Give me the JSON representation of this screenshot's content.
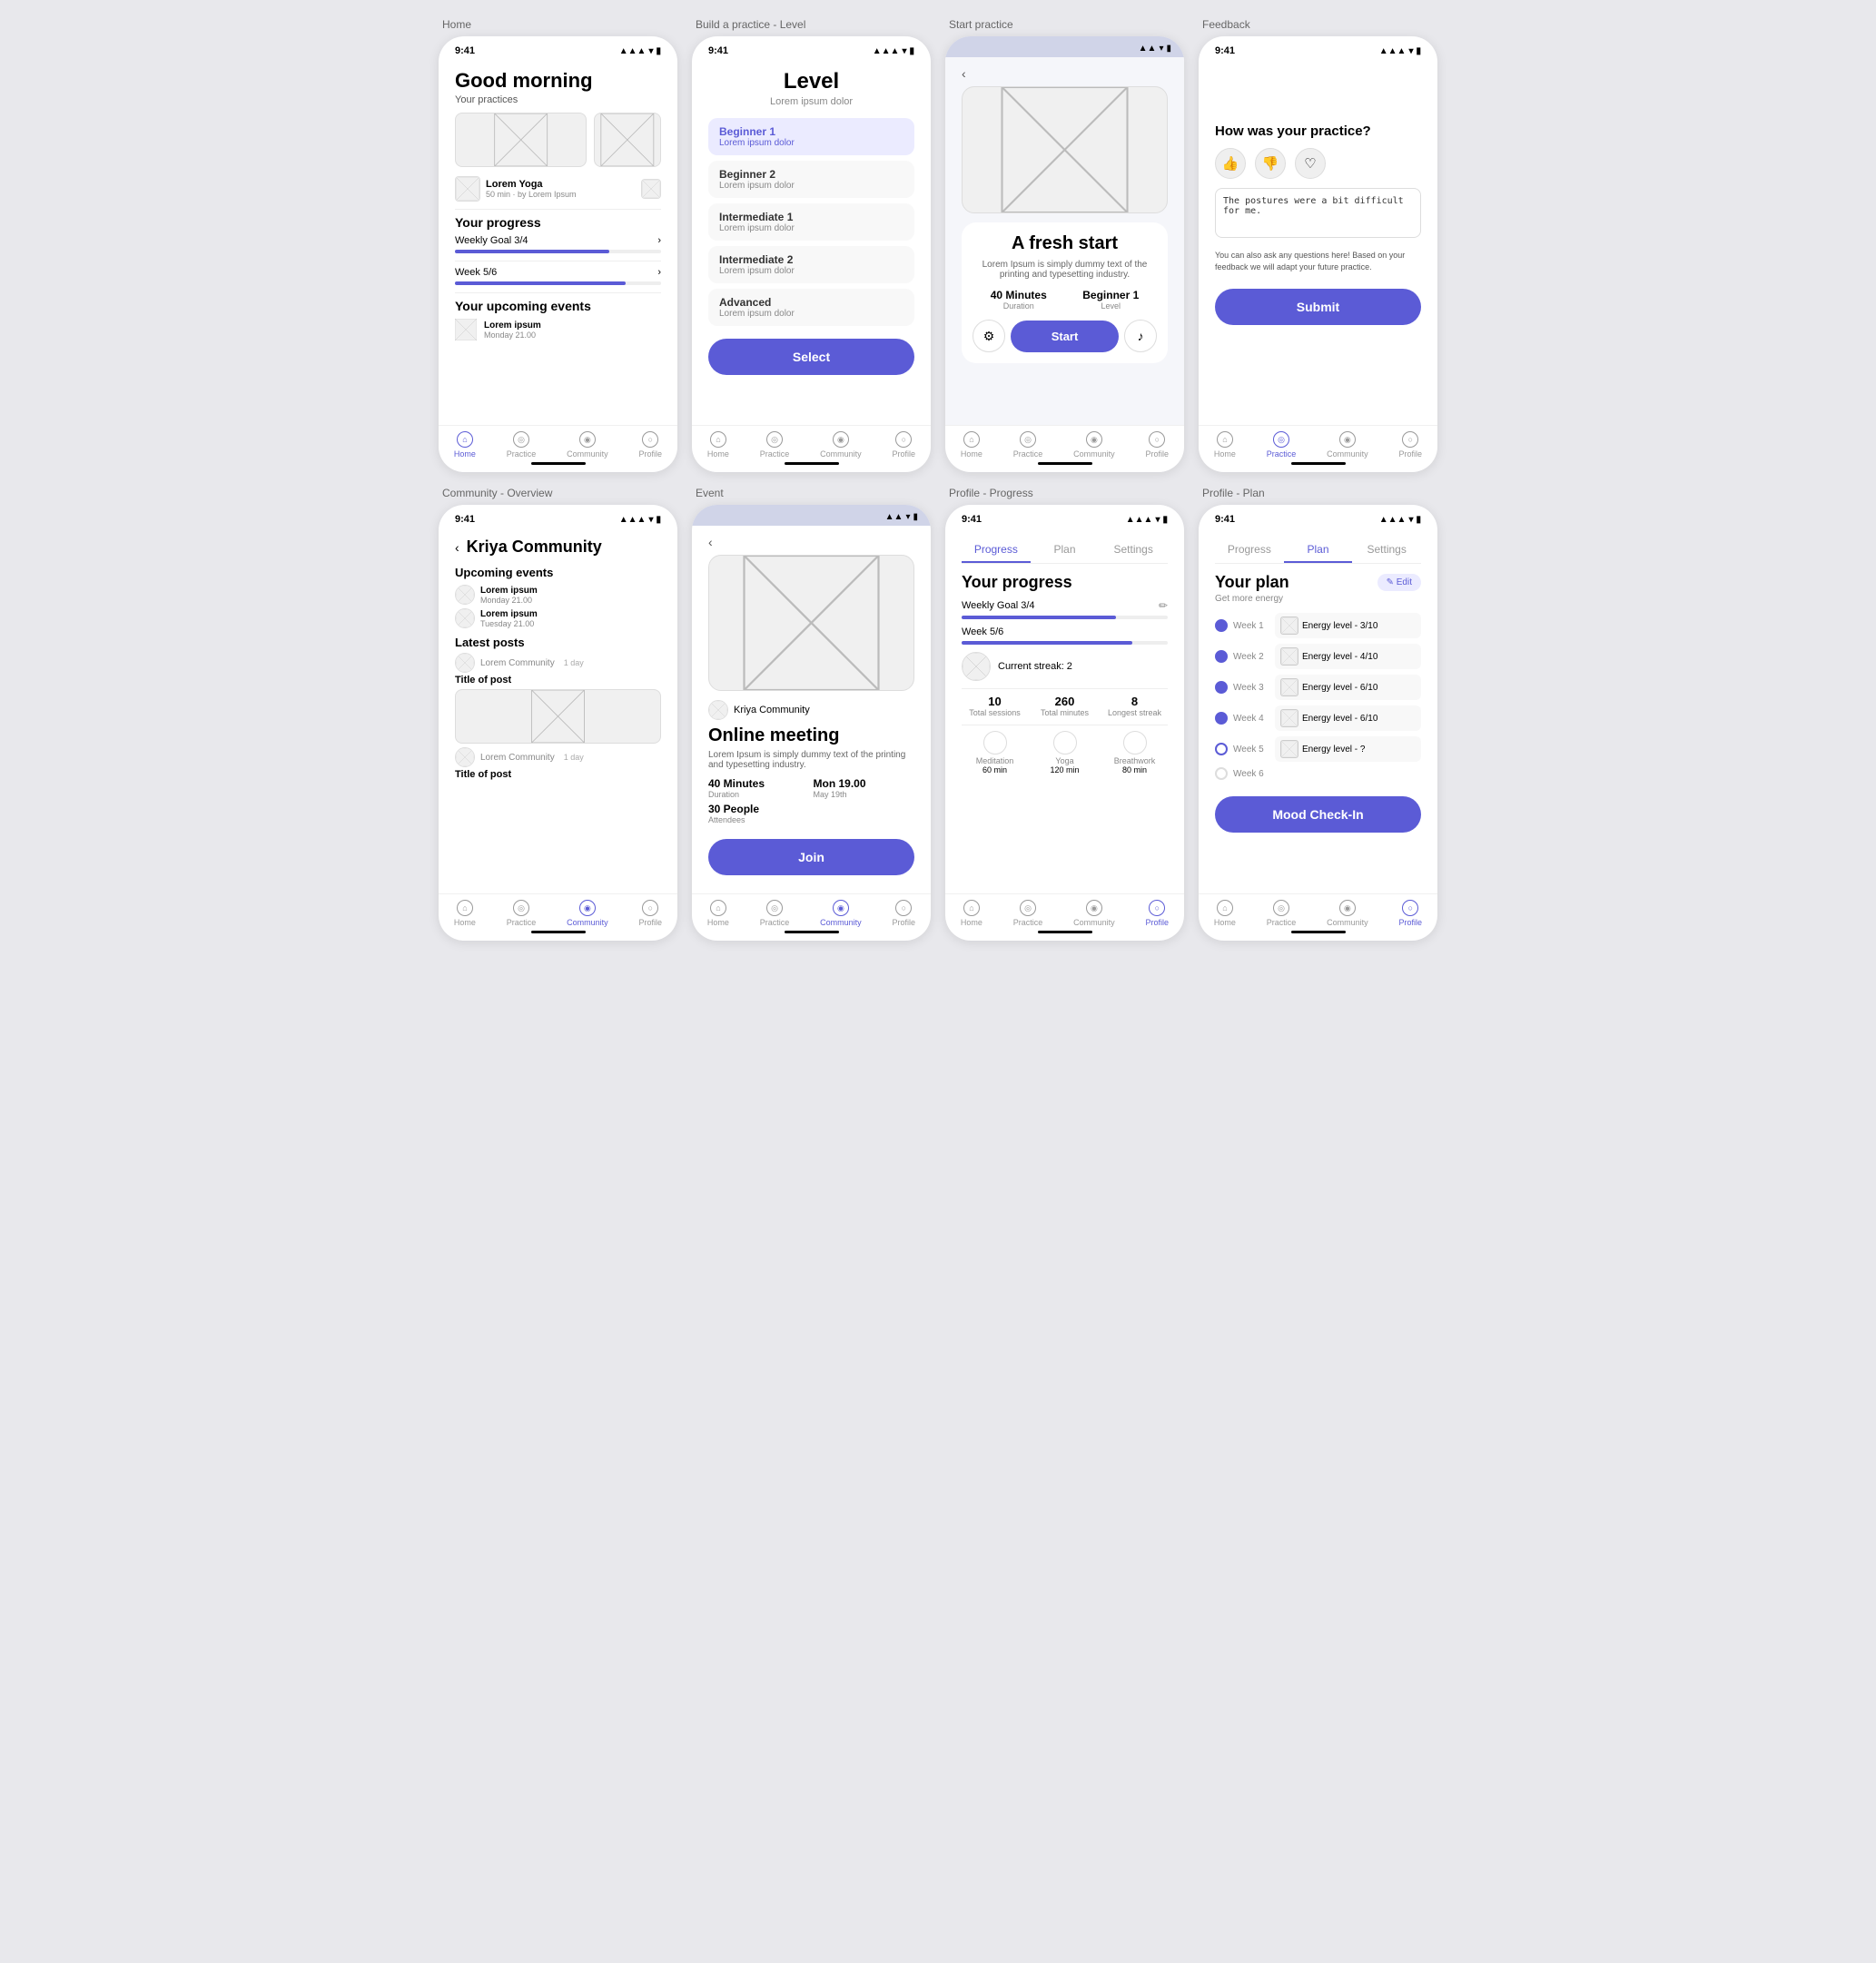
{
  "screens": [
    {
      "id": "home",
      "label": "Home",
      "time": "9:41",
      "greeting": "Good morning",
      "practices_label": "Your practices",
      "practice_title": "Lorem Yoga",
      "practice_sub": "50 min · by Lorem Ipsum",
      "progress_label": "Your progress",
      "weekly_goal": "Weekly Goal 3/4",
      "week": "Week 5/6",
      "events_label": "Your upcoming events",
      "event1": "Lorem ipsum",
      "event1_date": "Monday 21.00",
      "nav": [
        "Home",
        "Practice",
        "Community",
        "Profile"
      ],
      "active_nav": 0
    },
    {
      "id": "build-practice",
      "label": "Build a practice - Level",
      "time": "9:41",
      "title": "Level",
      "subtitle": "Lorem ipsum dolor",
      "levels": [
        {
          "name": "Beginner 1",
          "sub": "Lorem ipsum dolor",
          "active": true
        },
        {
          "name": "Beginner 2",
          "sub": "Lorem ipsum dolor",
          "active": false
        },
        {
          "name": "Intermediate 1",
          "sub": "Lorem ipsum dolor",
          "active": false
        },
        {
          "name": "Intermediate 2",
          "sub": "Lorem ipsum dolor",
          "active": false
        },
        {
          "name": "Advanced",
          "sub": "Lorem ipsum dolor",
          "active": false
        }
      ],
      "btn_label": "Select",
      "nav": [
        "Home",
        "Practice",
        "Community",
        "Profile"
      ],
      "active_nav": -1
    },
    {
      "id": "start-practice",
      "label": "Start practice",
      "time": "",
      "title": "A fresh start",
      "desc": "Lorem Ipsum is simply dummy text of the printing and typesetting industry.",
      "duration_val": "40 Minutes",
      "duration_label": "Duration",
      "level_val": "Beginner 1",
      "level_label": "Level",
      "btn_start": "Start",
      "nav": [
        "Home",
        "Practice",
        "Community",
        "Profile"
      ],
      "active_nav": -1
    },
    {
      "id": "feedback",
      "label": "Feedback",
      "time": "9:41",
      "title": "How was your practice?",
      "textarea_val": "The postures were a bit difficult for me.",
      "note": "You can also ask any questions here! Based on your feedback we will adapt your future practice.",
      "btn_submit": "Submit",
      "nav": [
        "Home",
        "Practice",
        "Community",
        "Profile"
      ],
      "active_nav": 1
    },
    {
      "id": "community-overview",
      "label": "Community - Overview",
      "time": "9:41",
      "title": "Kriya Community",
      "upcoming_label": "Upcoming events",
      "events": [
        {
          "text": "Lorem ipsum",
          "date": "Monday 21.00"
        },
        {
          "text": "Lorem ipsum",
          "date": "Tuesday 21.00"
        }
      ],
      "posts_label": "Latest posts",
      "posts": [
        {
          "org": "Lorem Community",
          "time": "1 day",
          "title": "Title of post"
        },
        {
          "org": "Lorem Community",
          "time": "1 day",
          "title": "Title of post"
        }
      ],
      "nav": [
        "Home",
        "Practice",
        "Community",
        "Profile"
      ],
      "active_nav": 2
    },
    {
      "id": "event",
      "label": "Event",
      "time": "",
      "org": "Kriya Community",
      "event_title": "Online meeting",
      "event_desc": "Lorem Ipsum is simply dummy text of the printing and typesetting industry.",
      "duration_val": "40 Minutes",
      "duration_label": "Duration",
      "date_val": "Mon 19.00",
      "date_label": "May 19th",
      "attendees_val": "30 People",
      "attendees_label": "Attendees",
      "btn_join": "Join",
      "nav": [
        "Home",
        "Practice",
        "Community",
        "Profile"
      ],
      "active_nav": 2
    },
    {
      "id": "profile-progress",
      "label": "Profile - Progress",
      "time": "9:41",
      "tabs": [
        "Progress",
        "Plan",
        "Settings"
      ],
      "active_tab": 0,
      "section_title": "Your progress",
      "weekly_goal": "Weekly Goal 3/4",
      "week": "Week 5/6",
      "streak_label": "Current streak: 2",
      "stats": [
        {
          "val": "10",
          "label": "Total sessions"
        },
        {
          "val": "260",
          "label": "Total minutes"
        },
        {
          "val": "8",
          "label": "Longest streak"
        }
      ],
      "practice_types": [
        {
          "label": "Meditation",
          "val": "60 min"
        },
        {
          "label": "Yoga",
          "val": "120 min"
        },
        {
          "label": "Breathwork",
          "val": "80 min"
        }
      ],
      "nav": [
        "Home",
        "Practice",
        "Community",
        "Profile"
      ],
      "active_nav": 3
    },
    {
      "id": "profile-plan",
      "label": "Profile - Plan",
      "time": "9:41",
      "tabs": [
        "Progress",
        "Plan",
        "Settings"
      ],
      "active_tab": 1,
      "plan_title": "Your plan",
      "plan_sub": "Get more energy",
      "edit_btn": "✎ Edit",
      "weeks": [
        {
          "label": "Week 1",
          "content": "Energy level - 3/10",
          "done": true
        },
        {
          "label": "Week 2",
          "content": "Energy level - 4/10",
          "done": true
        },
        {
          "label": "Week 3",
          "content": "Energy level - 6/10",
          "done": true
        },
        {
          "label": "Week 4",
          "content": "Energy level - 6/10",
          "done": true
        },
        {
          "label": "Week 5",
          "content": "Energy level - ?",
          "done": false,
          "active": true
        },
        {
          "label": "Week 6",
          "content": "",
          "done": false,
          "active": false
        }
      ],
      "btn_mood": "Mood Check-In",
      "nav": [
        "Home",
        "Practice",
        "Community",
        "Profile"
      ],
      "active_nav": 3
    }
  ]
}
